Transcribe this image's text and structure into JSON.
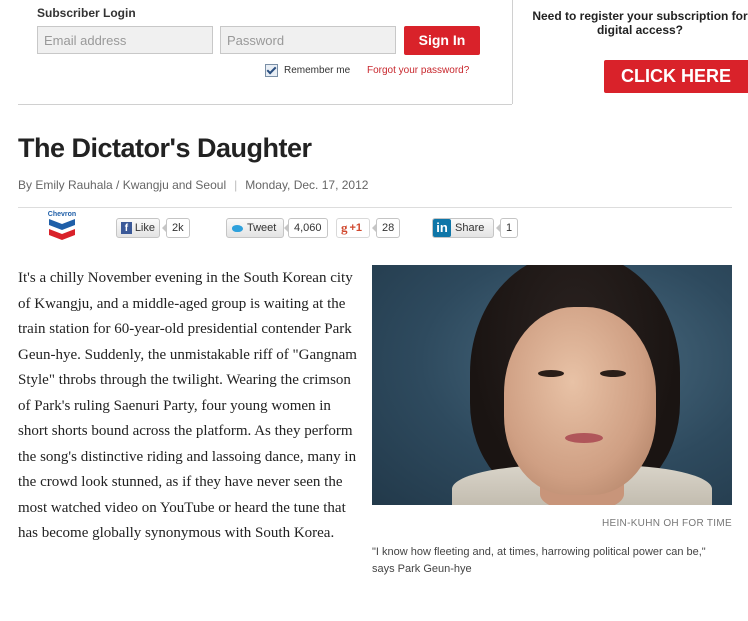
{
  "login": {
    "title": "Subscriber Login",
    "email_placeholder": "Email address",
    "password_placeholder": "Password",
    "signin_label": "Sign In",
    "remember_label": "Remember me",
    "remember_checked": true,
    "forgot_label": "Forgot your password?"
  },
  "register": {
    "line1": "Need to register your subscription for",
    "line2": "digital access?",
    "cta_label": "CLICK HERE"
  },
  "article": {
    "headline": "The Dictator's Daughter",
    "byline": "By Emily Rauhala / Kwangju and Seoul",
    "date": "Monday, Dec. 17, 2012",
    "body": "It's a chilly November evening in the South Korean city of Kwangju, and a middle-aged group is waiting at the train station for 60-year-old presidential contender Park Geun-hye. Suddenly, the unmistakable riff of \"Gangnam Style\" throbs through the twilight. Wearing the crimson of Park's ruling Saenuri Party, four young women in short shorts bound across the platform. As they perform the song's distinctive riding and lassoing dance, many in the crowd look stunned, as if they have never seen the most watched video on YouTube or heard the tune that has become globally synonymous with South Korea.",
    "photo_credit": "HEIN-KUHN OH FOR TIME",
    "caption": "\"I know how fleeting and, at times, harrowing political power can be,\" says Park Geun-hye"
  },
  "social": {
    "sponsor": "Chevron",
    "fb_label": "Like",
    "fb_count": "2k",
    "tw_label": "Tweet",
    "tw_count": "4,060",
    "gp_label": "+1",
    "gp_count": "28",
    "li_label": "Share",
    "li_count": "1"
  },
  "colors": {
    "accent_red": "#d9222a",
    "link_red": "#c8272d"
  }
}
